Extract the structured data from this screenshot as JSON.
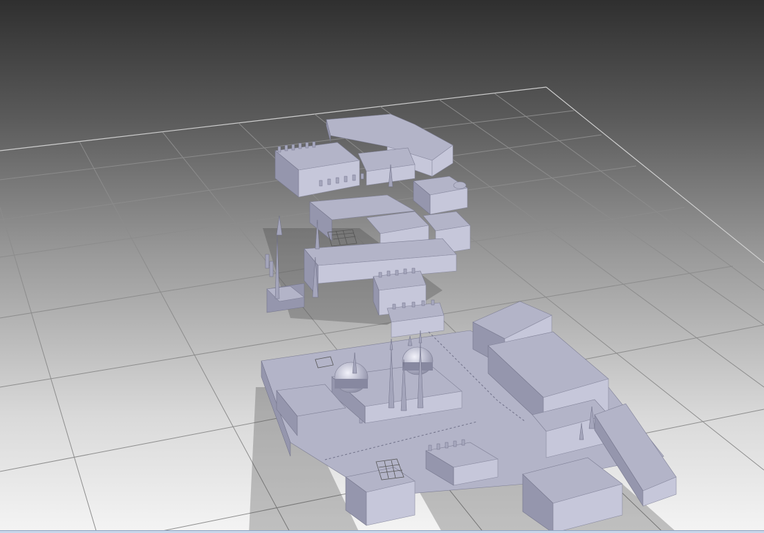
{
  "viewport": {
    "label": "",
    "background_top_color": "#2f2f2f",
    "background_bottom_color": "#f4f4f4",
    "grid_color": "#8c8c8c"
  },
  "scene": {
    "model_color": "#b3b4c8",
    "objects": [
      {
        "id": "upper-complex",
        "kind": "palace"
      },
      {
        "id": "lower-complex",
        "kind": "city-block"
      },
      {
        "id": "mosque",
        "kind": "mosque",
        "domes": 2,
        "minarets": 4
      },
      {
        "id": "standalone-minaret",
        "kind": "minaret"
      }
    ]
  }
}
